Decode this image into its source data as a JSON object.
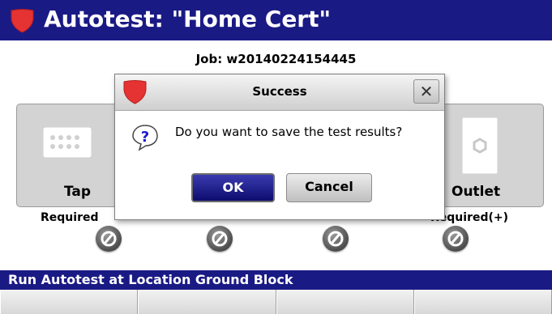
{
  "header": {
    "title": "Autotest: \"Home Cert\""
  },
  "job": {
    "label": "Job: w20140224154445"
  },
  "locations": [
    {
      "name": "Tap",
      "requirement": "Required"
    },
    {
      "name": "Outlet",
      "requirement": "Required(+)"
    }
  ],
  "status_bar": {
    "text": "Run Autotest at Location Ground Block"
  },
  "dialog": {
    "title": "Success",
    "message": "Do you want to save the test results?",
    "ok_label": "OK",
    "cancel_label": "Cancel",
    "close_glyph": "✕"
  },
  "icons": {
    "app_logo": "red-shield-icon",
    "tap": "coax-tap-icon",
    "outlet": "outlet-icon",
    "status": "not-tested-icon",
    "question": "question-icon"
  },
  "colors": {
    "title_bar": "#1a1a85",
    "logo": "#e03030",
    "ok_button": "#0c0c6e"
  }
}
